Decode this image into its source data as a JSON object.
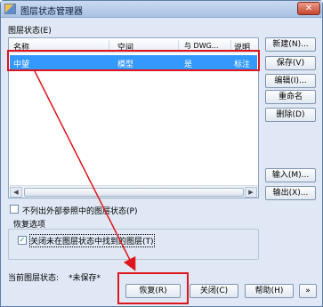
{
  "window": {
    "title": "图层状态管理器",
    "close_glyph": "✕",
    "icon": "layer-manager-icon"
  },
  "layer_states": {
    "label": "图层状态(E)",
    "columns": [
      "名称",
      "空间",
      "与 DWG...",
      "说明"
    ],
    "rows": [
      {
        "name": "中望",
        "space": "模型",
        "same_as_dwg": "是",
        "description": "标注",
        "selected": true
      }
    ]
  },
  "side_buttons": {
    "new": "新建(N)...",
    "save": "保存(V)",
    "edit": "编辑(I)...",
    "rename": "重命名",
    "delete": "删除(D)",
    "import": "输入(M)...",
    "export": "输出(X)..."
  },
  "options": {
    "exclude_xref_label": "不列出外部参照中的图层状态(P)",
    "exclude_xref_checked": false,
    "restore_group_label": "恢复选项",
    "turn_off_label": "关闭未在图层状态中找到的图层(T)",
    "turn_off_checked": true
  },
  "status": {
    "current_label": "当前图层状态:",
    "current_value": "*未保存*"
  },
  "bottom_buttons": {
    "restore": "恢复(R)",
    "close": "关闭(C)",
    "help": "帮助(H)",
    "more": "»"
  },
  "annotation": {
    "color": "#e0161c"
  }
}
